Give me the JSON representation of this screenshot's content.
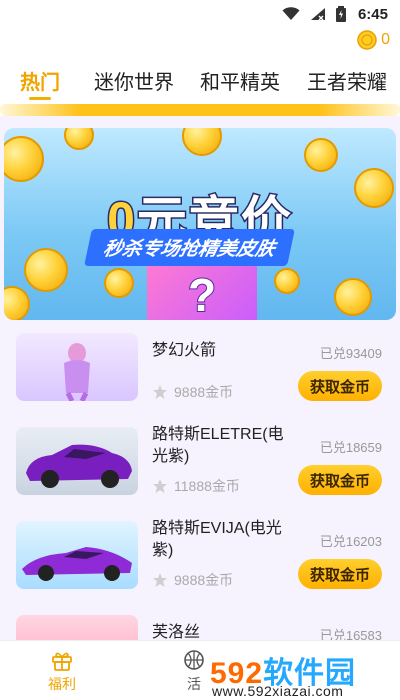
{
  "status_bar": {
    "time": "6:45"
  },
  "coins": {
    "balance": "0"
  },
  "tabs": [
    {
      "label": "热门",
      "active": true
    },
    {
      "label": "迷你世界",
      "active": false
    },
    {
      "label": "和平精英",
      "active": false
    },
    {
      "label": "王者荣耀",
      "active": false
    }
  ],
  "banner": {
    "title_zero": "0",
    "title_rest": "元竞价",
    "subtitle": "秒杀专场抢精美皮肤"
  },
  "items": [
    {
      "name": "梦幻火箭",
      "redeemed": "已兑93409",
      "price": "9888金币",
      "button": "获取金币"
    },
    {
      "name": "路特斯ELETRE(电光紫)",
      "redeemed": "已兑18659",
      "price": "11888金币",
      "button": "获取金币"
    },
    {
      "name": "路特斯EVIJA(电光紫)",
      "redeemed": "已兑16203",
      "price": "9888金币",
      "button": "获取金币"
    },
    {
      "name": "芙洛丝",
      "redeemed": "已兑16583",
      "price": "",
      "button": ""
    }
  ],
  "bottom_nav": [
    {
      "label": "福利",
      "icon": "gift-icon",
      "active": true
    },
    {
      "label": "活",
      "icon": "basketball-icon",
      "active": false
    }
  ],
  "watermark": {
    "brand_num": "592",
    "brand_text": "软件园",
    "url": "www.592xiazai.com"
  },
  "colors": {
    "accent": "#f0a400",
    "button": "#ffb100",
    "list_bg": "#f6f3ff"
  }
}
